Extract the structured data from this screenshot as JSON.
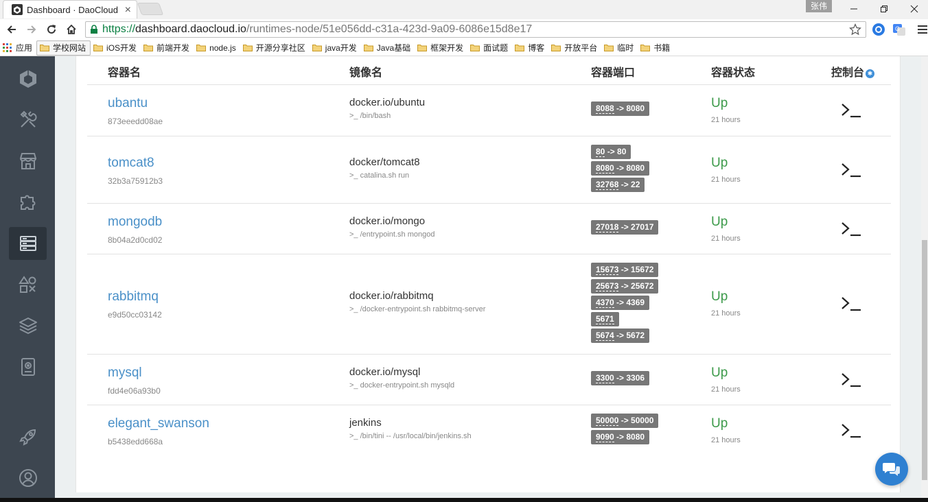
{
  "browser": {
    "tab_title": "Dashboard · DaoCloud",
    "user_badge": "张伟",
    "url_scheme": "https://",
    "url_host": "dashboard.daocloud.io",
    "url_path": "/runtimes-node/51e056dd-c31a-423d-9a09-6086e15d8e17"
  },
  "bookmarks": {
    "apps_label": "应用",
    "items": [
      "学校网站",
      "iOS开发",
      "前端开发",
      "node.js",
      "开源分享社区",
      "java开发",
      "Java基础",
      "框架开发",
      "面试题",
      "博客",
      "开放平台",
      "临时",
      "书籍"
    ]
  },
  "sidebar": {
    "items": [
      "logo-icon",
      "tools-icon",
      "store-icon",
      "puzzle-icon",
      "server-icon",
      "shapes-icon",
      "layers-icon",
      "disk-icon",
      "rocket-icon",
      "user-icon"
    ],
    "active": "server-icon"
  },
  "table": {
    "headers": {
      "name": "容器名",
      "image": "镜像名",
      "ports": "容器端口",
      "status": "容器状态",
      "console": "控制台"
    },
    "rows": [
      {
        "name": "ubantu",
        "id": "873eeedd08ae",
        "image": "docker.io/ubuntu",
        "cmd": ">_ /bin/bash",
        "ports": [
          [
            "8088",
            " -> 8080"
          ]
        ],
        "status": "Up",
        "uptime": "21 hours"
      },
      {
        "name": "tomcat8",
        "id": "32b3a75912b3",
        "image": "docker/tomcat8",
        "cmd": ">_ catalina.sh run",
        "ports": [
          [
            "80",
            " -> 80"
          ],
          [
            "8080",
            " -> 8080"
          ],
          [
            "32768",
            " -> 22"
          ]
        ],
        "status": "Up",
        "uptime": "21 hours"
      },
      {
        "name": "mongodb",
        "id": "8b04a2d0cd02",
        "image": "docker.io/mongo",
        "cmd": ">_ /entrypoint.sh mongod",
        "ports": [
          [
            "27018",
            " -> 27017"
          ]
        ],
        "status": "Up",
        "uptime": "21 hours"
      },
      {
        "name": "rabbitmq",
        "id": "e9d50cc03142",
        "image": "docker.io/rabbitmq",
        "cmd": ">_ /docker-entrypoint.sh rabbitmq-server",
        "ports": [
          [
            "15673",
            " -> 15672"
          ],
          [
            "25673",
            " -> 25672"
          ],
          [
            "4370",
            " -> 4369"
          ],
          [
            "5671",
            ""
          ],
          [
            "5674",
            " -> 5672"
          ]
        ],
        "status": "Up",
        "uptime": "21 hours"
      },
      {
        "name": "mysql",
        "id": "fdd4e06a93b0",
        "image": "docker.io/mysql",
        "cmd": ">_ docker-entrypoint.sh mysqld",
        "ports": [
          [
            "3300",
            " -> 3306"
          ]
        ],
        "status": "Up",
        "uptime": "21 hours"
      },
      {
        "name": "elegant_swanson",
        "id": "b5438edd668a",
        "image": "jenkins",
        "cmd": ">_ /bin/tini -- /usr/local/bin/jenkins.sh",
        "ports": [
          [
            "50000",
            " -> 50000"
          ],
          [
            "9090",
            " -> 8080"
          ]
        ],
        "status": "Up",
        "uptime": "21 hours"
      }
    ]
  },
  "colors": {
    "sidebar_bg": "#3d4650",
    "link": "#4a90c8",
    "status_up": "#3c9a4a",
    "port_badge": "#777777",
    "chat_button": "#2f80d1"
  }
}
